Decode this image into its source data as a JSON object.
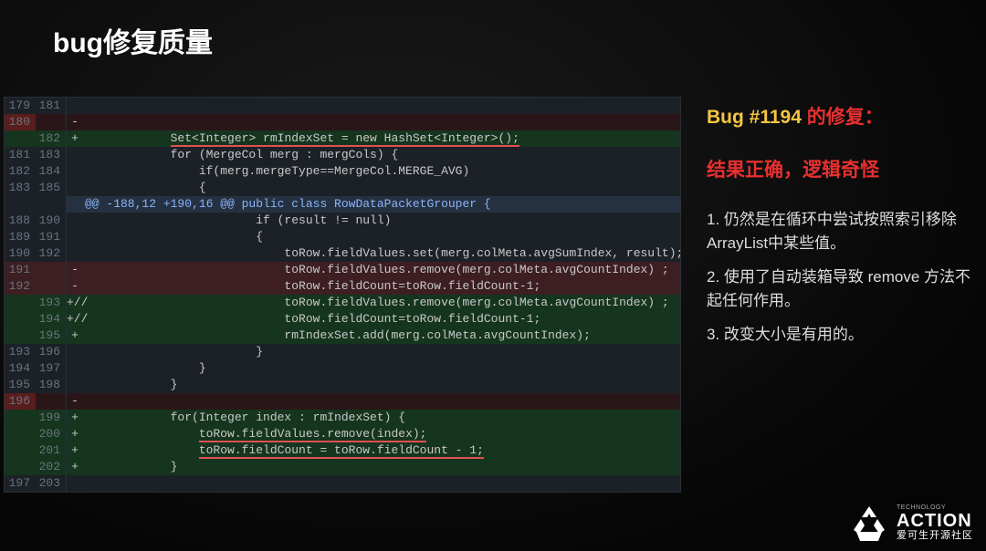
{
  "title": "bug修复质量",
  "sidebar": {
    "bug_label": "Bug #1194 ",
    "fix_label": "的修复：",
    "subtitle": "结果正确，逻辑奇怪",
    "points": [
      "1. 仍然是在循环中尝试按照索引移除ArrayList中某些值。",
      "2. 使用了自动装箱导致 remove 方法不起任何作用。",
      "3. 改变大小是有用的。"
    ]
  },
  "logo": {
    "top": "TECHNOLOGY",
    "name": "ACTION",
    "sub": "爱可生开源社区"
  },
  "diff": {
    "rows": [
      {
        "old": "179",
        "new": "181",
        "sign": "",
        "cls": "context",
        "code": ""
      },
      {
        "old": "180",
        "new": "",
        "sign": "-",
        "cls": "del-dark",
        "code": ""
      },
      {
        "old": "",
        "new": "182",
        "sign": "+",
        "cls": "add",
        "code": "            Set<Integer> rmIndexSet = new HashSet<Integer>();",
        "u": true
      },
      {
        "old": "181",
        "new": "183",
        "sign": "",
        "cls": "context",
        "code": "            for (MergeCol merg : mergCols) {"
      },
      {
        "old": "182",
        "new": "184",
        "sign": "",
        "cls": "context",
        "code": "                if(merg.mergeType==MergeCol.MERGE_AVG)"
      },
      {
        "old": "183",
        "new": "185",
        "sign": "",
        "cls": "context",
        "code": "                {"
      },
      {
        "old": "",
        "new": "",
        "sign": "",
        "cls": "hunk",
        "code": "@@ -188,12 +190,16 @@ public class RowDataPacketGrouper {"
      },
      {
        "old": "188",
        "new": "190",
        "sign": "",
        "cls": "context",
        "code": "                        if (result != null)"
      },
      {
        "old": "189",
        "new": "191",
        "sign": "",
        "cls": "context",
        "code": "                        {"
      },
      {
        "old": "190",
        "new": "192",
        "sign": "",
        "cls": "context",
        "code": "                            toRow.fieldValues.set(merg.colMeta.avgSumIndex, result);"
      },
      {
        "old": "191",
        "new": "",
        "sign": "-",
        "cls": "del",
        "code": "                            toRow.fieldValues.remove(merg.colMeta.avgCountIndex) ;"
      },
      {
        "old": "192",
        "new": "",
        "sign": "-",
        "cls": "del",
        "code": "                            toRow.fieldCount=toRow.fieldCount-1;"
      },
      {
        "old": "",
        "new": "193",
        "sign": "+//",
        "cls": "add",
        "code": "                            toRow.fieldValues.remove(merg.colMeta.avgCountIndex) ;"
      },
      {
        "old": "",
        "new": "194",
        "sign": "+//",
        "cls": "add",
        "code": "                            toRow.fieldCount=toRow.fieldCount-1;"
      },
      {
        "old": "",
        "new": "195",
        "sign": "+",
        "cls": "add",
        "code": "                            rmIndexSet.add(merg.colMeta.avgCountIndex);"
      },
      {
        "old": "193",
        "new": "196",
        "sign": "",
        "cls": "context",
        "code": "                        }"
      },
      {
        "old": "194",
        "new": "197",
        "sign": "",
        "cls": "context",
        "code": "                }"
      },
      {
        "old": "195",
        "new": "198",
        "sign": "",
        "cls": "context",
        "code": "            }"
      },
      {
        "old": "196",
        "new": "",
        "sign": "-",
        "cls": "del-dark",
        "code": ""
      },
      {
        "old": "",
        "new": "199",
        "sign": "+",
        "cls": "add",
        "code": "            for(Integer index : rmIndexSet) {"
      },
      {
        "old": "",
        "new": "200",
        "sign": "+",
        "cls": "add",
        "code": "                toRow.fieldValues.remove(index);",
        "u": true
      },
      {
        "old": "",
        "new": "201",
        "sign": "+",
        "cls": "add",
        "code": "                toRow.fieldCount = toRow.fieldCount - 1;",
        "u": true
      },
      {
        "old": "",
        "new": "202",
        "sign": "+",
        "cls": "add",
        "code": "            }"
      },
      {
        "old": "197",
        "new": "203",
        "sign": "",
        "cls": "context",
        "code": ""
      }
    ]
  }
}
